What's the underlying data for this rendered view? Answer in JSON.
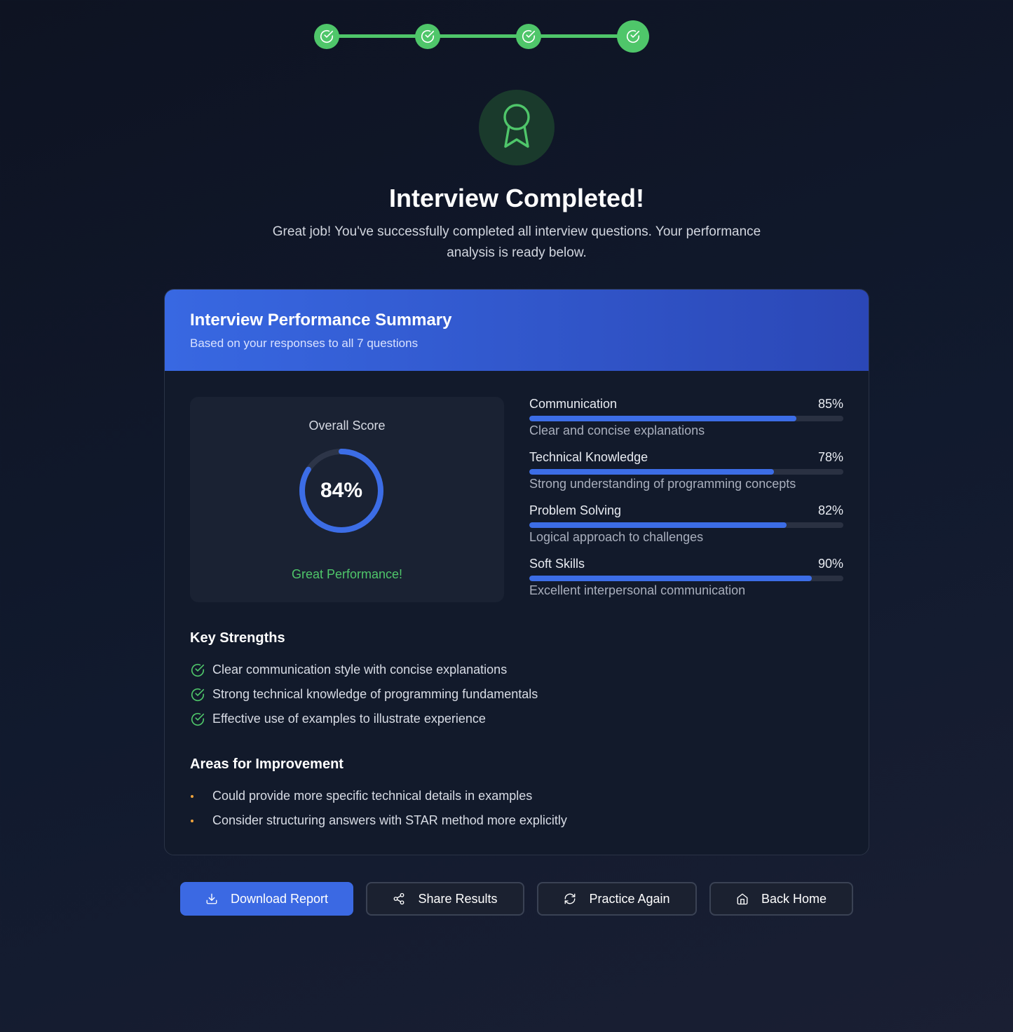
{
  "colors": {
    "success": "#4fc66a",
    "accent": "#3b69e3",
    "warning": "#f0a43c"
  },
  "progress": {
    "steps": 4,
    "completed": 4
  },
  "hero": {
    "icon": "award-icon",
    "title": "Interview Completed!",
    "subtitle": "Great job! You've successfully completed all interview questions. Your performance analysis is ready below."
  },
  "summary": {
    "title": "Interview Performance Summary",
    "subtitle": "Based on your responses to all 7 questions",
    "overall": {
      "label": "Overall Score",
      "value": 84,
      "value_text": "84%",
      "message": "Great Performance!"
    },
    "metrics": [
      {
        "name": "Communication",
        "value": 85,
        "pct": "85%",
        "desc": "Clear and concise explanations"
      },
      {
        "name": "Technical Knowledge",
        "value": 78,
        "pct": "78%",
        "desc": "Strong understanding of programming concepts"
      },
      {
        "name": "Problem Solving",
        "value": 82,
        "pct": "82%",
        "desc": "Logical approach to challenges"
      },
      {
        "name": "Soft Skills",
        "value": 90,
        "pct": "90%",
        "desc": "Excellent interpersonal communication"
      }
    ],
    "strengths": {
      "title": "Key Strengths",
      "items": [
        "Clear communication style with concise explanations",
        "Strong technical knowledge of programming fundamentals",
        "Effective use of examples to illustrate experience"
      ]
    },
    "improvements": {
      "title": "Areas for Improvement",
      "items": [
        "Could provide more specific technical details in examples",
        "Consider structuring answers with STAR method more explicitly"
      ]
    }
  },
  "actions": {
    "download": {
      "label": "Download Report",
      "icon": "download-icon"
    },
    "share": {
      "label": "Share Results",
      "icon": "share-icon"
    },
    "practice": {
      "label": "Practice Again",
      "icon": "refresh-icon"
    },
    "home": {
      "label": "Back Home",
      "icon": "home-icon"
    }
  }
}
